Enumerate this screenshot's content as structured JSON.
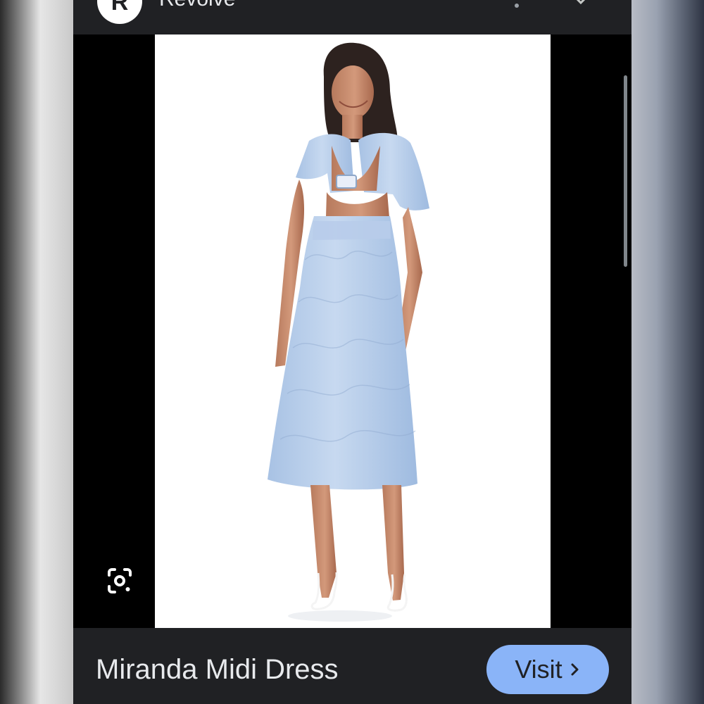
{
  "header": {
    "avatar_letter": "R",
    "site_name": "Revolve"
  },
  "product": {
    "title": "Miranda Midi Dress"
  },
  "actions": {
    "visit_label": "Visit"
  },
  "icons": {
    "more": "more-vert-icon",
    "close": "close-icon",
    "lens": "google-lens-icon",
    "visit_chevron": "chevron-right-icon"
  },
  "colors": {
    "sheet_background": "#202124",
    "viewer_background": "#000000",
    "photo_background": "#ffffff",
    "visit_button": "#8ab4f8",
    "text_primary": "#e8eaed"
  }
}
